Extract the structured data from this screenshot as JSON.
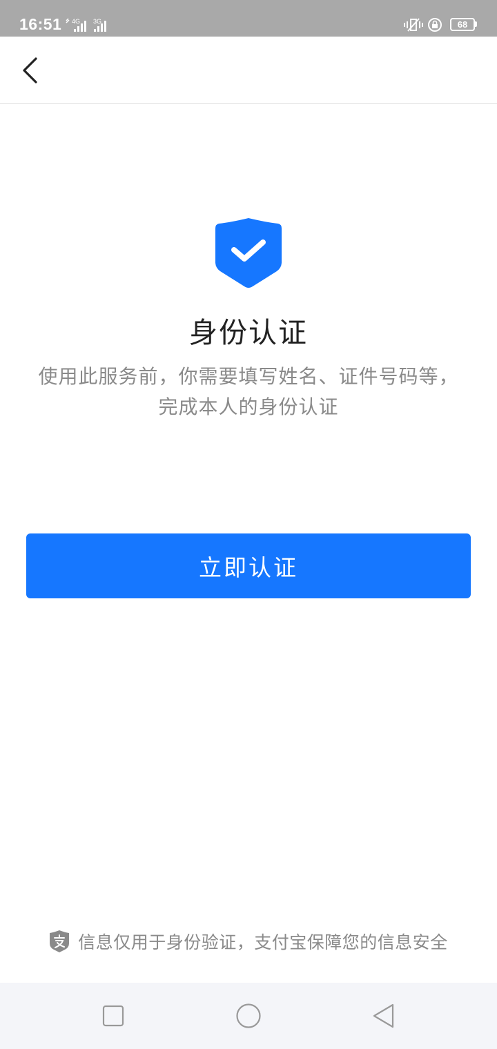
{
  "status_bar": {
    "time": "16:51",
    "network_1": "4G",
    "network_2": "3G",
    "battery": "68"
  },
  "nav": {
    "back_icon": "chevron-left-icon"
  },
  "main": {
    "icon": "shield-check-icon",
    "title": "身份认证",
    "desc_line1": "使用此服务前，你需要填写姓名、证件号码等，",
    "desc_line2": "完成本人的身份认证",
    "button_label": "立即认证"
  },
  "footer": {
    "icon": "alipay-shield-icon",
    "text": "信息仅用于身份验证，支付宝保障您的信息安全"
  },
  "system_nav": {
    "recent": "square-icon",
    "home": "circle-icon",
    "back": "triangle-back-icon"
  },
  "colors": {
    "accent": "#1677ff",
    "status_bar": "#a9a9a9",
    "text_secondary": "#8a8a8a"
  }
}
